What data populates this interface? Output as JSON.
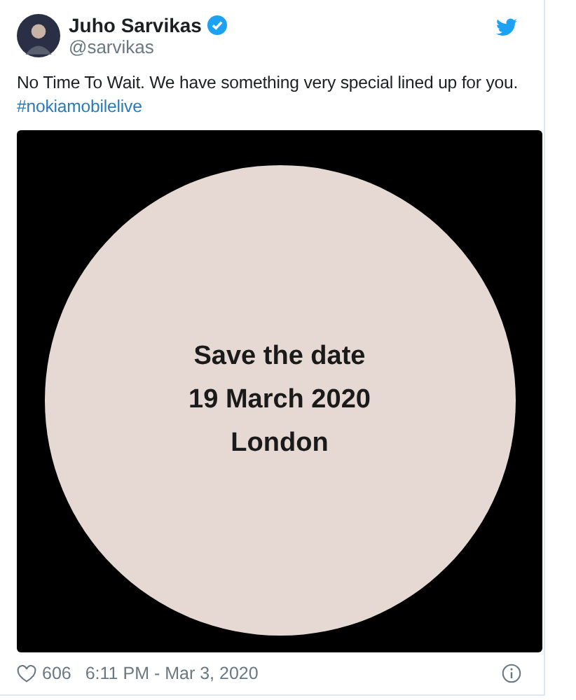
{
  "author": {
    "name": "Juho Sarvikas",
    "verified": true,
    "handle": "@sarvikas"
  },
  "tweet": {
    "text": "No Time To Wait. We have something very special lined up for you.",
    "hashtag": "#nokiamobilelive"
  },
  "media": {
    "lines": [
      "Save the date",
      "19 March 2020",
      "London"
    ]
  },
  "footer": {
    "likes": "606",
    "timestamp": "6:11 PM - Mar 3, 2020"
  }
}
